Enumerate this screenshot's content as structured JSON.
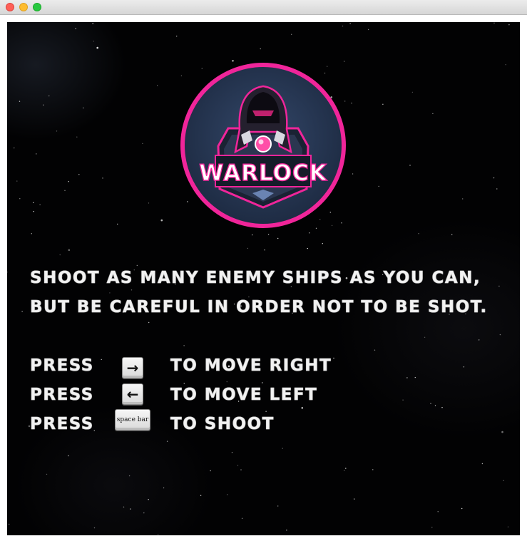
{
  "window": {
    "controls": [
      "close",
      "minimize",
      "maximize"
    ]
  },
  "logo": {
    "text": "WARLOCK",
    "ring_color": "#f0259a",
    "orb_color": "#ff4fa8",
    "background_color": "#2b3b55"
  },
  "instructions": {
    "line1": "Shoot as many enemy ships as you can,",
    "line2": "but be careful in order not to be shot."
  },
  "controls": [
    {
      "press": "Press",
      "key_icon": "right-arrow-key",
      "key_label": "→",
      "action": "to move right"
    },
    {
      "press": "Press",
      "key_icon": "left-arrow-key",
      "key_label": "←",
      "action": "to move left"
    },
    {
      "press": "Press",
      "key_icon": "space-bar-key",
      "key_label": "space bar",
      "action": "to shoot"
    }
  ],
  "colors": {
    "background": "#020203",
    "text": "#f2f2f2",
    "accent": "#f0259a"
  }
}
